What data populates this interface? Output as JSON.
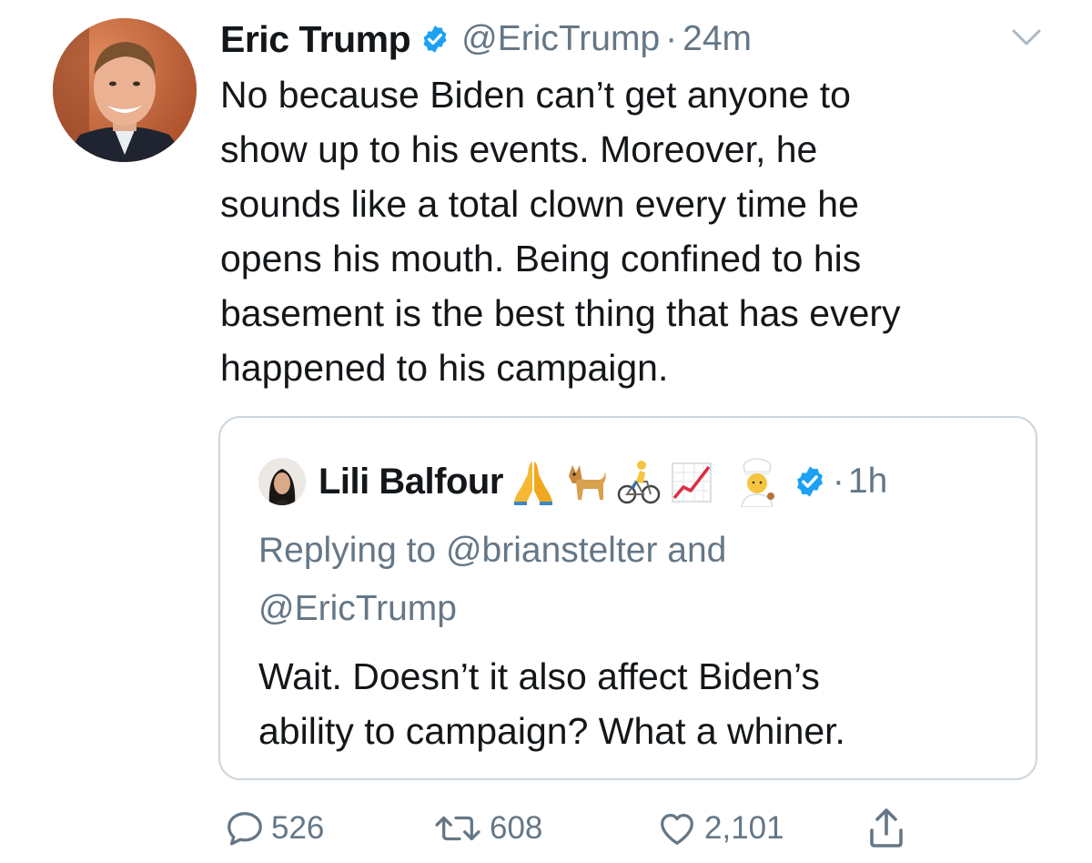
{
  "tweet": {
    "author": {
      "display_name": "Eric Trump",
      "handle": "@EricTrump",
      "verified": true
    },
    "separator": "·",
    "time": "24m",
    "text": "No because Biden can’t get anyone to\nshow up to his events. Moreover, he\nsounds like a total clown every time he\nopens his mouth. Being confined to his\nbasement is the best thing that has every\nhappened to his campaign.",
    "menu_icon": "chevron-down-icon"
  },
  "quoted_tweet": {
    "author": {
      "display_name": "Lili Balfour",
      "name_emojis": [
        "folded-hands",
        "dog",
        "cyclist",
        "chart-increasing",
        "cook"
      ],
      "verified": true
    },
    "separator": "·",
    "time": "1h",
    "replying_to": "Replying to @brianstelter and\n@EricTrump",
    "text": "Wait. Doesn’t it also affect Biden’s\nability to campaign? What a whiner."
  },
  "actions": {
    "replies": "526",
    "retweets": "608",
    "likes": "2,101",
    "icons": [
      "reply-icon",
      "retweet-icon",
      "like-icon",
      "share-icon"
    ]
  },
  "colors": {
    "text_primary": "#14171a",
    "text_secondary": "#657786",
    "verified_blue": "#1da1f2",
    "border": "#ccd6dd"
  }
}
